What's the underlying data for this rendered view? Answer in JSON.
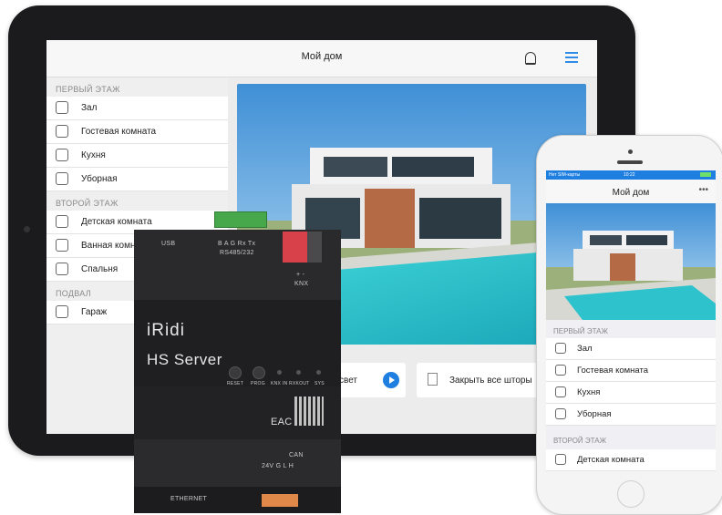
{
  "tablet": {
    "title": "Мой дом",
    "sections": [
      {
        "title": "ПЕРВЫЙ ЭТАЖ",
        "items": [
          "Зал",
          "Гостевая комната",
          "Кухня",
          "Уборная"
        ]
      },
      {
        "title": "ВТОРОЙ ЭТАЖ",
        "items": [
          "Детская комната",
          "Ванная комн",
          "Спальня"
        ]
      },
      {
        "title": "ПОДВАЛ",
        "items": [
          "Гараж"
        ]
      }
    ],
    "scene_buttons": [
      "свет",
      "Закрыть все шторы"
    ]
  },
  "device": {
    "usb": "USB",
    "bus_pins": "B A G Rx Tx",
    "bus_label": "RS485/232",
    "knx_pins": "+  -",
    "knx_label": "KNX",
    "brand": "iRidi",
    "model": "HS Server",
    "buttons": [
      "RESET",
      "PROG"
    ],
    "leds": [
      "KNX IN",
      "RXKOUT",
      "SYS"
    ],
    "cert": "EAC",
    "can_label": "CAN",
    "power_pins": "24V  G  L  H",
    "ethernet": "ETHERNET"
  },
  "phone": {
    "status_left": "Нет SIM-карты",
    "time": "10:22",
    "title": "Мой дом",
    "more": "•••",
    "sections": [
      {
        "title": "ПЕРВЫЙ ЭТАЖ",
        "items": [
          "Зал",
          "Гостевая комната",
          "Кухня",
          "Уборная"
        ]
      },
      {
        "title": "ВТОРОЙ ЭТАЖ",
        "items": [
          "Детская комната"
        ]
      }
    ]
  }
}
